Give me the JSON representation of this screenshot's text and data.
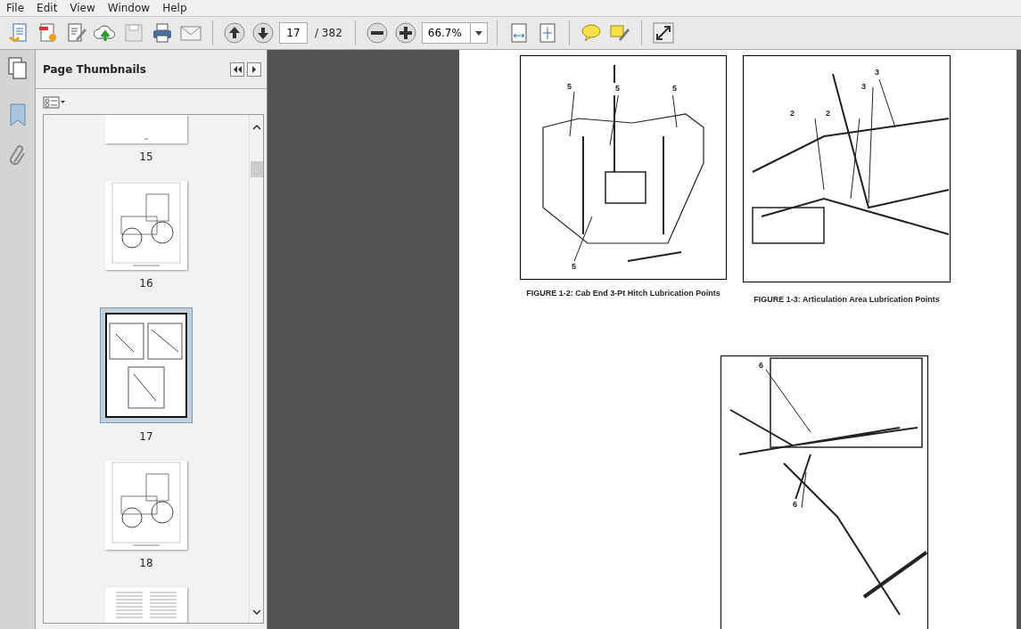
{
  "menu": [
    "File",
    "Edit",
    "View",
    "Window",
    "Help"
  ],
  "toolbar": {
    "page_number": "17",
    "page_total": "/ 382",
    "zoom": "66.7%"
  },
  "panel": {
    "title": "Page Thumbnails"
  },
  "thumbnails": [
    {
      "label": "15",
      "selected": false,
      "kind": "blank"
    },
    {
      "label": "16",
      "selected": false,
      "kind": "tractor"
    },
    {
      "label": "17",
      "selected": true,
      "kind": "figures"
    },
    {
      "label": "18",
      "selected": false,
      "kind": "tractor"
    },
    {
      "selected": false,
      "kind": "text"
    }
  ],
  "document": {
    "figures": [
      {
        "caption": "FIGURE 1-2: Cab End 3-Pt Hitch Lubrication Points",
        "callouts": [
          "5",
          "5",
          "5",
          "5"
        ]
      },
      {
        "caption": "FIGURE 1-3: Articulation Area Lubrication Points",
        "callouts": [
          "3",
          "3",
          "2",
          "2"
        ]
      },
      {
        "callouts": [
          "6",
          "6"
        ]
      }
    ]
  }
}
